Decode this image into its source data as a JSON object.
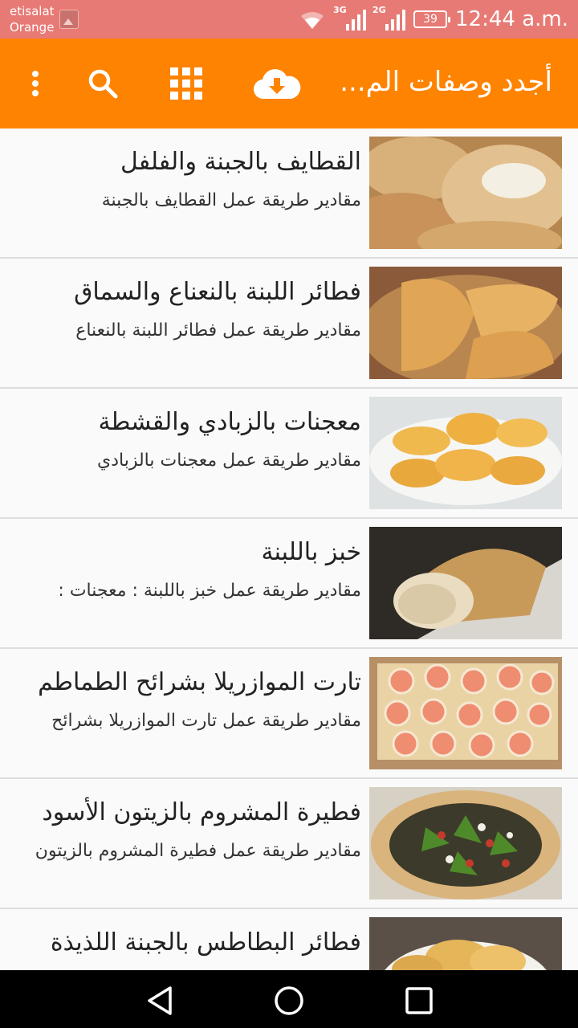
{
  "status_bar": {
    "carrier_line1": "etisalat",
    "carrier_line2": "Orange",
    "network_1": "3G",
    "network_2": "2G",
    "battery": "39",
    "time": "12:44 a.m."
  },
  "app_bar": {
    "title": "أجدد وصفات الم...",
    "icons": [
      "cloud-download-icon",
      "grid-icon",
      "search-icon",
      "more-vert-icon"
    ]
  },
  "recipes": [
    {
      "title": "القطايف بالجبنة والفلفل",
      "subtitle": "مقادير طريقة عمل القطايف بالجبنة"
    },
    {
      "title": "فطائر اللبنة بالنعناع والسماق",
      "subtitle": "مقادير طريقة عمل فطائر اللبنة بالنعناع"
    },
    {
      "title": "معجنات بالزبادي والقشطة",
      "subtitle": "مقادير طريقة عمل معجنات بالزبادي"
    },
    {
      "title": "خبز باللبنة",
      "subtitle": "مقادير طريقة عمل خبز باللبنة : معجنات :"
    },
    {
      "title": "تارت الموازريلا بشرائح الطماطم",
      "subtitle": "مقادير طريقة عمل تارت الموازريلا بشرائح"
    },
    {
      "title": "فطيرة المشروم بالزيتون الأسود",
      "subtitle": "مقادير طريقة عمل فطيرة المشروم بالزيتون"
    },
    {
      "title": "فطائر البطاطس بالجبنة اللذيذة",
      "subtitle": ""
    }
  ],
  "nav_bar": {
    "icons": [
      "back-icon",
      "home-icon",
      "recents-icon"
    ]
  },
  "colors": {
    "status_bar": "#e77a75",
    "app_bar": "#fe8300",
    "background": "#fafafa"
  }
}
